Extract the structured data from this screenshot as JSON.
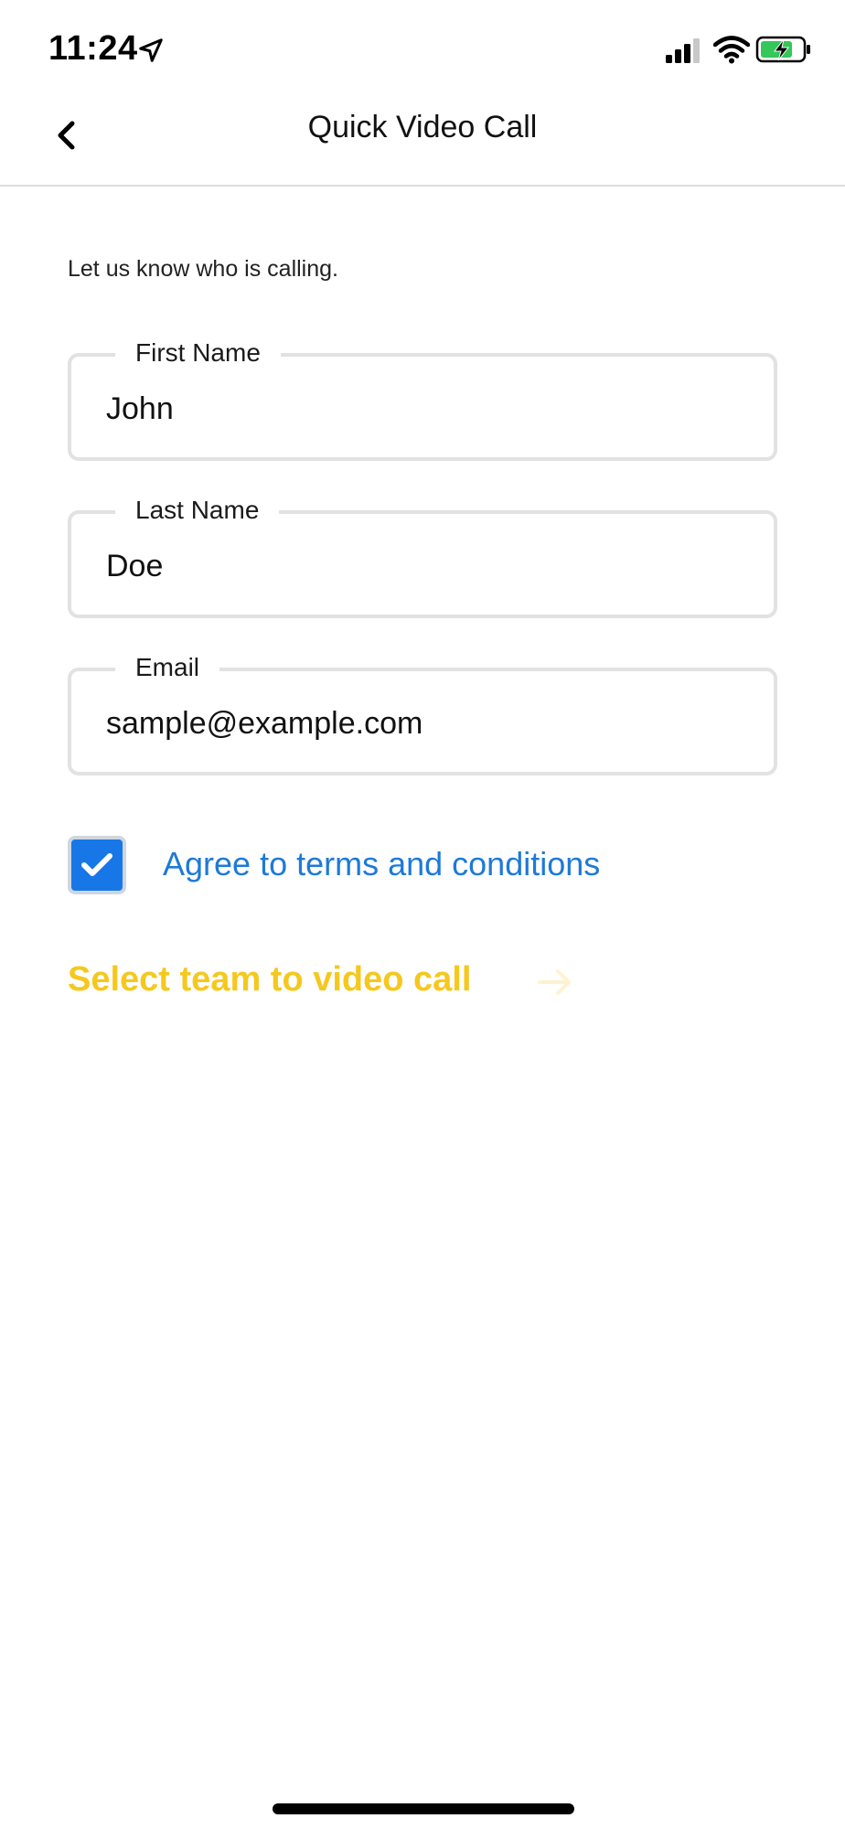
{
  "status_bar": {
    "time": "11:24",
    "icons": [
      "location-arrow-icon",
      "cellular-signal-icon",
      "wifi-icon",
      "battery-charging-icon"
    ]
  },
  "nav": {
    "title": "Quick Video Call",
    "back_icon": "chevron-left-icon"
  },
  "form": {
    "intro": "Let us know who is calling.",
    "first_name": {
      "label": "First Name",
      "value": "John"
    },
    "last_name": {
      "label": "Last Name",
      "value": "Doe"
    },
    "email": {
      "label": "Email",
      "value": "sample@example.com"
    },
    "terms": {
      "label": "Agree to terms and conditions",
      "checked": true
    },
    "team_link": {
      "label": "Select team to video call",
      "icon": "arrow-right-icon"
    }
  },
  "colors": {
    "accent_blue": "#1877e6",
    "link_blue": "#1d7ad8",
    "cta_yellow": "#f6c81e",
    "field_border": "#e2e2e2"
  }
}
